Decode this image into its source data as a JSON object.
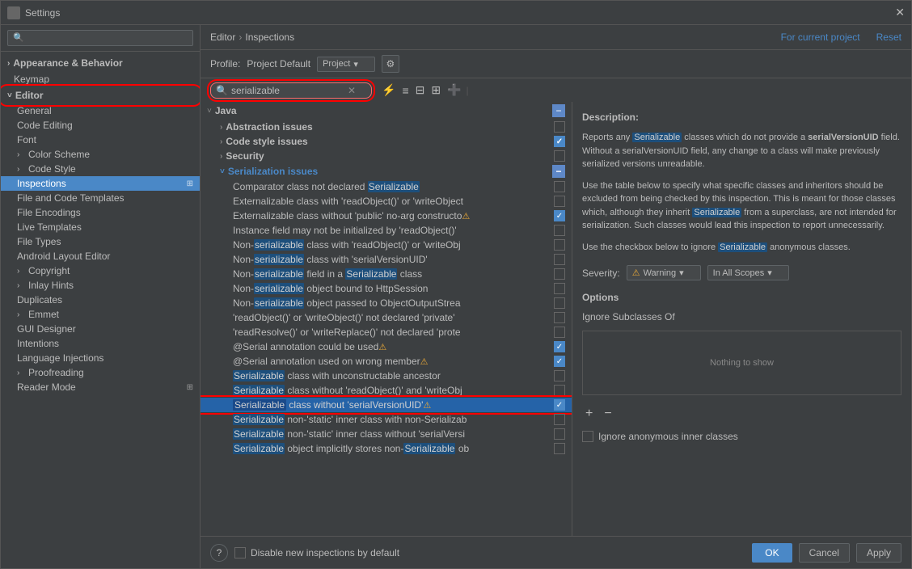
{
  "window": {
    "title": "Settings"
  },
  "header": {
    "breadcrumb_editor": "Editor",
    "breadcrumb_sep": "›",
    "breadcrumb_inspections": "Inspections",
    "for_project": "For current project",
    "reset": "Reset"
  },
  "toolbar": {
    "profile_label": "Profile:",
    "profile_value": "Project Default",
    "profile_dropdown": "Project"
  },
  "search": {
    "placeholder": "serializable",
    "value": "serializable"
  },
  "sidebar": {
    "search_placeholder": "🔍",
    "items": [
      {
        "label": "Appearance & Behavior",
        "level": 0,
        "arrow": "›",
        "selected": false,
        "bold": true
      },
      {
        "label": "Keymap",
        "level": 0,
        "arrow": "",
        "selected": false,
        "bold": false
      },
      {
        "label": "Editor",
        "level": 0,
        "arrow": "˅",
        "selected": false,
        "bold": true,
        "highlighted": true
      },
      {
        "label": "General",
        "level": 1,
        "arrow": "",
        "selected": false
      },
      {
        "label": "Code Editing",
        "level": 1,
        "arrow": "",
        "selected": false
      },
      {
        "label": "Font",
        "level": 1,
        "arrow": "",
        "selected": false
      },
      {
        "label": "Color Scheme",
        "level": 1,
        "arrow": "›",
        "selected": false
      },
      {
        "label": "Code Style",
        "level": 1,
        "arrow": "›",
        "selected": false
      },
      {
        "label": "Inspections",
        "level": 1,
        "arrow": "",
        "selected": true
      },
      {
        "label": "File and Code Templates",
        "level": 1,
        "arrow": "",
        "selected": false
      },
      {
        "label": "File Encodings",
        "level": 1,
        "arrow": "",
        "selected": false
      },
      {
        "label": "Live Templates",
        "level": 1,
        "arrow": "",
        "selected": false
      },
      {
        "label": "File Types",
        "level": 1,
        "arrow": "",
        "selected": false
      },
      {
        "label": "Android Layout Editor",
        "level": 1,
        "arrow": "",
        "selected": false
      },
      {
        "label": "Copyright",
        "level": 1,
        "arrow": "›",
        "selected": false
      },
      {
        "label": "Inlay Hints",
        "level": 1,
        "arrow": "›",
        "selected": false
      },
      {
        "label": "Duplicates",
        "level": 1,
        "arrow": "",
        "selected": false
      },
      {
        "label": "Emmet",
        "level": 1,
        "arrow": "›",
        "selected": false
      },
      {
        "label": "GUI Designer",
        "level": 1,
        "arrow": "",
        "selected": false
      },
      {
        "label": "Intentions",
        "level": 1,
        "arrow": "",
        "selected": false
      },
      {
        "label": "Language Injections",
        "level": 1,
        "arrow": "",
        "selected": false
      },
      {
        "label": "Proofreading",
        "level": 1,
        "arrow": "›",
        "selected": false
      },
      {
        "label": "Reader Mode",
        "level": 1,
        "arrow": "",
        "selected": false
      }
    ]
  },
  "tree": {
    "java_label": "Java",
    "categories": [
      {
        "label": "Abstraction issues",
        "arrow": "›",
        "has_minus": false,
        "checked": false
      },
      {
        "label": "Code style issues",
        "arrow": "›",
        "has_minus": false,
        "checked": true
      },
      {
        "label": "Security",
        "arrow": "›",
        "has_minus": false,
        "checked": false
      },
      {
        "label": "Serialization issues",
        "arrow": "˅",
        "has_minus": true,
        "checked": false
      }
    ],
    "items": [
      {
        "label": "Comparator class not declared Serializable",
        "highlight": "Serializable",
        "warn": false,
        "checked": false,
        "selected": false
      },
      {
        "label": "Externalizable class with 'readObject()' or 'writeObject",
        "highlight": "serializable",
        "warn": false,
        "checked": false,
        "selected": false
      },
      {
        "label": "Externalizable class without 'public' no-arg constructo",
        "highlight": "",
        "warn": true,
        "checked": true,
        "selected": false
      },
      {
        "label": "Instance field may not be initialized by 'readObject()'",
        "highlight": "",
        "warn": false,
        "checked": false,
        "selected": false
      },
      {
        "label": "Non-serializable class with 'readObject()' or 'writeObj",
        "highlight": "serializable",
        "warn": false,
        "checked": false,
        "selected": false
      },
      {
        "label": "Non-serializable class with 'serialVersionUID'",
        "highlight": "serializable",
        "warn": false,
        "checked": false,
        "selected": false
      },
      {
        "label": "Non-serializable field in a Serializable class",
        "highlight": "serializable",
        "warn": false,
        "checked": false,
        "selected": false
      },
      {
        "label": "Non-serializable object bound to HttpSession",
        "highlight": "serializable",
        "warn": false,
        "checked": false,
        "selected": false
      },
      {
        "label": "Non-serializable object passed to ObjectOutputStrea",
        "highlight": "serializable",
        "warn": false,
        "checked": false,
        "selected": false
      },
      {
        "label": "'readObject()' or 'writeObject()' not declared 'private'",
        "highlight": "",
        "warn": false,
        "checked": false,
        "selected": false
      },
      {
        "label": "'readResolve()' or 'writeReplace()' not declared 'prote",
        "highlight": "",
        "warn": false,
        "checked": false,
        "selected": false
      },
      {
        "label": "@Serial annotation could be used",
        "highlight": "",
        "warn": true,
        "checked": true,
        "selected": false
      },
      {
        "label": "@Serial annotation used on wrong member",
        "highlight": "",
        "warn": true,
        "checked": true,
        "selected": false
      },
      {
        "label": "Serializable class with unconstructable ancestor",
        "highlight": "Serializable",
        "warn": false,
        "checked": false,
        "selected": false
      },
      {
        "label": "Serializable class without 'readObject()' and 'writeObj",
        "highlight": "Serializable",
        "warn": false,
        "checked": false,
        "selected": false
      },
      {
        "label": "Serializable class without 'serialVersionUID'",
        "highlight": "Serializable",
        "warn": true,
        "checked": true,
        "selected": true
      },
      {
        "label": "Serializable non-'static' inner class with non-Serializab",
        "highlight": "Serializable",
        "warn": false,
        "checked": false,
        "selected": false
      },
      {
        "label": "Serializable non-'static' inner class without 'serialVersi",
        "highlight": "Serializable",
        "warn": false,
        "checked": false,
        "selected": false
      },
      {
        "label": "Serializable object implicitly stores non-Serializable ob",
        "highlight": "Serializable",
        "warn": false,
        "checked": false,
        "selected": false
      }
    ]
  },
  "description": {
    "title": "Description:",
    "text1": "Reports any",
    "highlight1": "Serializable",
    "text2": "classes which do not provide a",
    "bold1": "serialVersionUID",
    "text3": "field. Without a serialVersionUID field, any change to a class will make previously serialized versions unreadable.",
    "text4": "Use the table below to specify what specific classes and inheritors should be excluded from being checked by this inspection. This is meant for those classes which, although they inherit",
    "highlight2": "Serializable",
    "text5": "from a superclass, are not intended for serialization. Such classes would lead this inspection to report unnecessarily.",
    "text6": "Use the checkbox below to ignore",
    "highlight3": "Serializable",
    "text7": "anonymous classes.",
    "severity_label": "Severity:",
    "severity_warn_icon": "⚠",
    "severity_value": "Warning",
    "scope_value": "In All Scopes",
    "options_title": "Options",
    "ignore_subclasses_label": "Ignore Subclasses Of",
    "nothing_to_show": "Nothing to show",
    "add_btn": "+",
    "remove_btn": "−",
    "ignore_label": "Ignore anonymous inner classes"
  },
  "bottom": {
    "disable_label": "Disable new inspections by default",
    "ok": "OK",
    "cancel": "Cancel",
    "apply": "Apply",
    "help": "?"
  }
}
